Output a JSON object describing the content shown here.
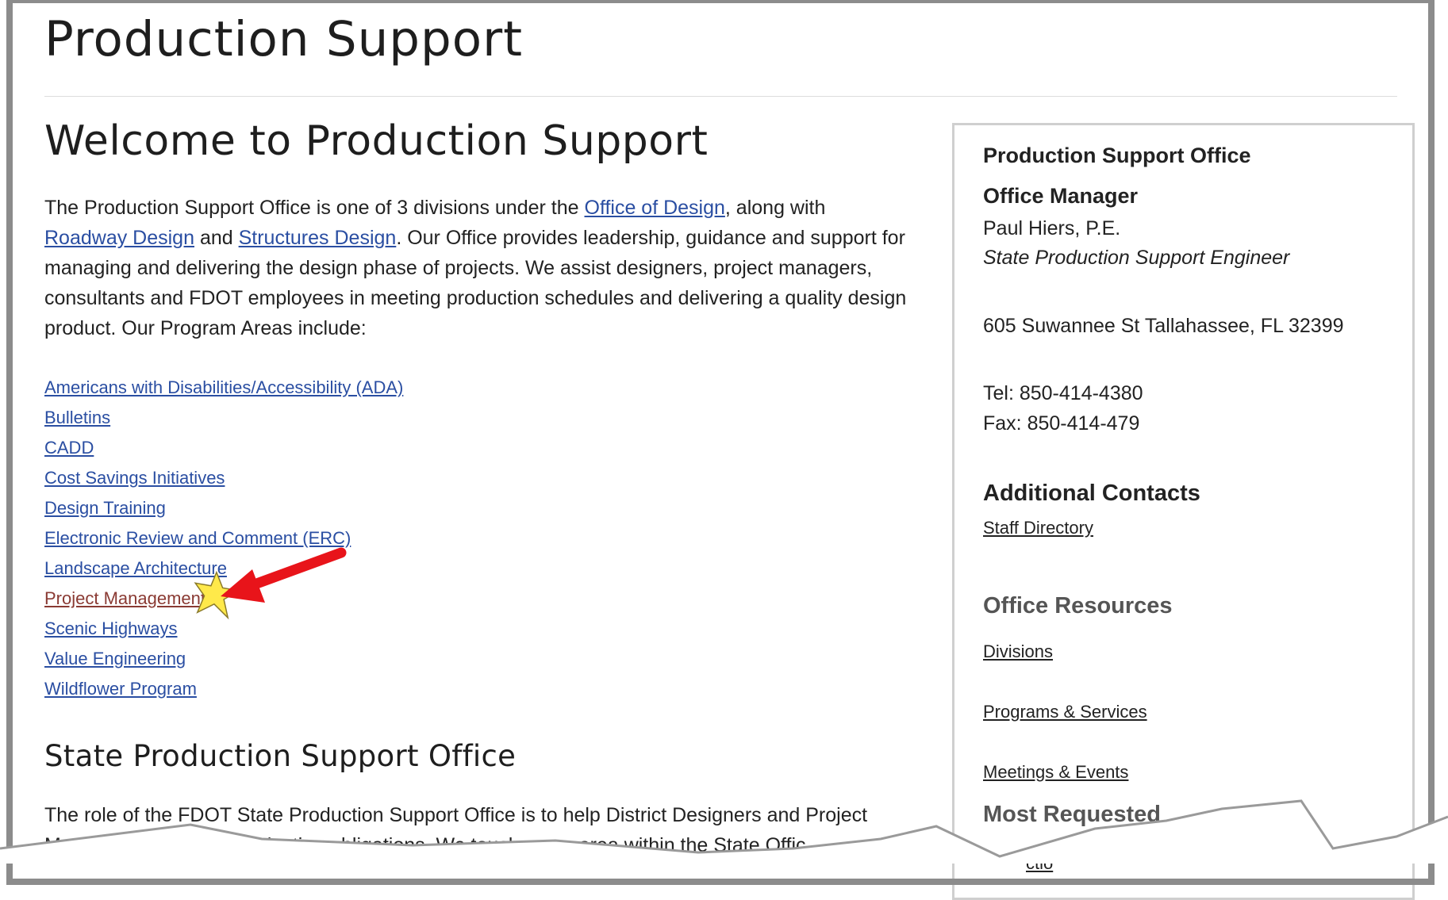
{
  "page": {
    "title": "Production Support"
  },
  "welcome": {
    "heading": "Welcome to Production Support",
    "intro_1": "The Production Support Office is one of 3 divisions under the ",
    "office_of_design_link": "Office of Design",
    "intro_2": ", along with ",
    "roadway_design_link": "Roadway Design",
    "intro_3": " and ",
    "structures_design_link": "Structures Design",
    "intro_4": ". Our Office provides leadership, guidance and support for managing and delivering the design phase of projects. We assist designers, project managers, consultants and FDOT employees in meeting production schedules and delivering a quality design product. Our Program Areas include:"
  },
  "programs": [
    "Americans with Disabilities/Accessibility (ADA)",
    "Bulletins",
    "CADD",
    "Cost Savings Initiatives",
    "Design Training",
    "Electronic Review and Comment (ERC)",
    "Landscape Architecture",
    "Project Management",
    "Scenic Highways",
    "Value Engineering",
    "Wildflower Program"
  ],
  "state_office": {
    "heading": "State Production Support Office",
    "text_1": "The role of the FDOT State Production Support Office is to help District Designers and Project",
    "text_2": "Mana",
    "text_3": "duction obligations. We touch every area within the State Offic"
  },
  "sidebar": {
    "office_title": "Production Support Office",
    "manager_heading": "Office Manager",
    "manager_name": "Paul Hiers, P.E.",
    "manager_role": "State Production Support Engineer",
    "address": "605 Suwannee St Tallahassee, FL 32399",
    "tel": "Tel: 850-414-4380",
    "fax": "Fax: 850-414-479",
    "additional_contacts_heading": "Additional Contacts",
    "staff_directory_link": "Staff Directory",
    "office_resources_heading": "Office Resources",
    "divisions_link": "Divisions",
    "programs_services_link": "Programs & Services",
    "meetings_events_link": "Meetings & Events",
    "most_requested_heading": "Most Requested",
    "partial_link": "ctio"
  },
  "colors": {
    "link": "#2a4ea2",
    "visited_link": "#8a3a33",
    "annotation_arrow": "#e8141a",
    "annotation_star": "#ffe94a"
  },
  "annotation": {
    "arrow_icon": "red-arrow-icon",
    "star_icon": "yellow-star-icon"
  }
}
